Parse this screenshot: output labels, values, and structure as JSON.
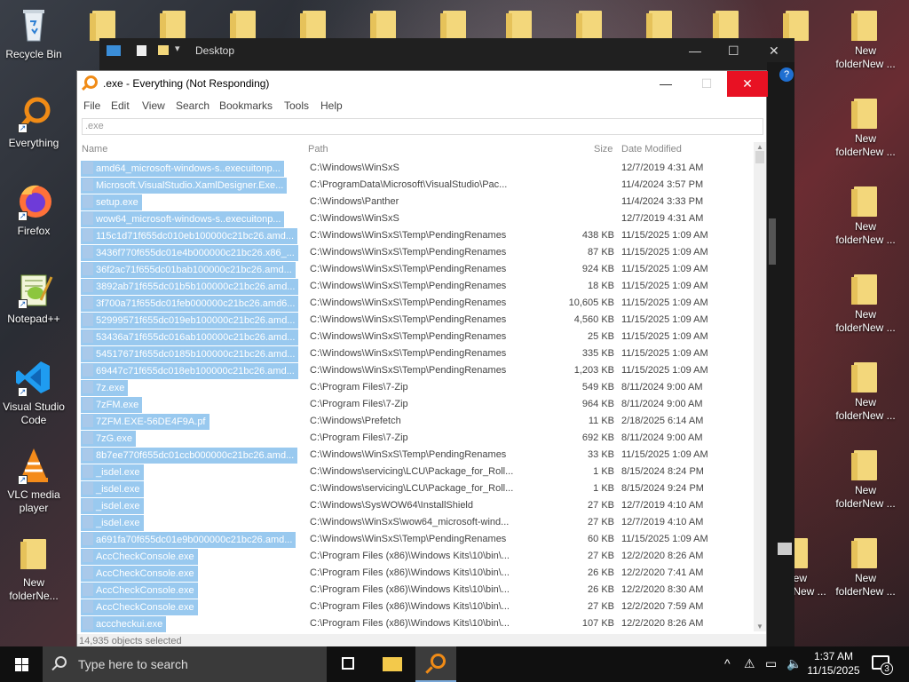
{
  "desktop_left": [
    {
      "label": "Recycle Bin",
      "icon": "recycle-bin-icon"
    },
    {
      "label": "Everything",
      "icon": "everything-icon"
    },
    {
      "label": "Firefox",
      "icon": "firefox-icon"
    },
    {
      "label": "Notepad++",
      "icon": "notepad-plus-plus-icon"
    },
    {
      "label": "Visual Studio Code",
      "icon": "vscode-icon"
    },
    {
      "label": "VLC media player",
      "icon": "vlc-icon"
    },
    {
      "label": "New folderNe...",
      "icon": "folder-icon"
    }
  ],
  "desktop_right": {
    "label_a": "New",
    "label_b": "folderNew ..."
  },
  "explorer": {
    "title": "Desktop"
  },
  "everything": {
    "title": ".exe - Everything (Not Responding)",
    "menu": [
      "File",
      "Edit",
      "View",
      "Search",
      "Bookmarks",
      "Tools",
      "Help"
    ],
    "search_value": ".exe",
    "columns": {
      "name": "Name",
      "path": "Path",
      "size": "Size",
      "date": "Date Modified"
    },
    "rows": [
      {
        "name": "amd64_microsoft-windows-s..execuitonp...",
        "path": "C:\\Windows\\WinSxS",
        "size": "",
        "date": "12/7/2019 4:31 AM"
      },
      {
        "name": "Microsoft.VisualStudio.XamlDesigner.Exe...",
        "path": "C:\\ProgramData\\Microsoft\\VisualStudio\\Pac...",
        "size": "",
        "date": "11/4/2024 3:57 PM"
      },
      {
        "name": "setup.exe",
        "path": "C:\\Windows\\Panther",
        "size": "",
        "date": "11/4/2024 3:33 PM"
      },
      {
        "name": "wow64_microsoft-windows-s..execuitonp...",
        "path": "C:\\Windows\\WinSxS",
        "size": "",
        "date": "12/7/2019 4:31 AM"
      },
      {
        "name": "115c1d71f655dc010eb100000c21bc26.amd...",
        "path": "C:\\Windows\\WinSxS\\Temp\\PendingRenames",
        "size": "438 KB",
        "date": "11/15/2025 1:09 AM"
      },
      {
        "name": "3436f770f655dc01e4b000000c21bc26.x86_...",
        "path": "C:\\Windows\\WinSxS\\Temp\\PendingRenames",
        "size": "87 KB",
        "date": "11/15/2025 1:09 AM"
      },
      {
        "name": "36f2ac71f655dc01bab100000c21bc26.amd...",
        "path": "C:\\Windows\\WinSxS\\Temp\\PendingRenames",
        "size": "924 KB",
        "date": "11/15/2025 1:09 AM"
      },
      {
        "name": "3892ab71f655dc01b5b100000c21bc26.amd...",
        "path": "C:\\Windows\\WinSxS\\Temp\\PendingRenames",
        "size": "18 KB",
        "date": "11/15/2025 1:09 AM"
      },
      {
        "name": "3f700a71f655dc01feb000000c21bc26.amd6...",
        "path": "C:\\Windows\\WinSxS\\Temp\\PendingRenames",
        "size": "10,605 KB",
        "date": "11/15/2025 1:09 AM"
      },
      {
        "name": "52999571f655dc019eb100000c21bc26.amd...",
        "path": "C:\\Windows\\WinSxS\\Temp\\PendingRenames",
        "size": "4,560 KB",
        "date": "11/15/2025 1:09 AM"
      },
      {
        "name": "53436a71f655dc016ab100000c21bc26.amd...",
        "path": "C:\\Windows\\WinSxS\\Temp\\PendingRenames",
        "size": "25 KB",
        "date": "11/15/2025 1:09 AM"
      },
      {
        "name": "54517671f655dc0185b100000c21bc26.amd...",
        "path": "C:\\Windows\\WinSxS\\Temp\\PendingRenames",
        "size": "335 KB",
        "date": "11/15/2025 1:09 AM"
      },
      {
        "name": "69447c71f655dc018eb100000c21bc26.amd...",
        "path": "C:\\Windows\\WinSxS\\Temp\\PendingRenames",
        "size": "1,203 KB",
        "date": "11/15/2025 1:09 AM"
      },
      {
        "name": "7z.exe",
        "path": "C:\\Program Files\\7-Zip",
        "size": "549 KB",
        "date": "8/11/2024 9:00 AM"
      },
      {
        "name": "7zFM.exe",
        "path": "C:\\Program Files\\7-Zip",
        "size": "964 KB",
        "date": "8/11/2024 9:00 AM"
      },
      {
        "name": "7ZFM.EXE-56DE4F9A.pf",
        "path": "C:\\Windows\\Prefetch",
        "size": "11 KB",
        "date": "2/18/2025 6:14 AM"
      },
      {
        "name": "7zG.exe",
        "path": "C:\\Program Files\\7-Zip",
        "size": "692 KB",
        "date": "8/11/2024 9:00 AM"
      },
      {
        "name": "8b7ee770f655dc01ccb000000c21bc26.amd...",
        "path": "C:\\Windows\\WinSxS\\Temp\\PendingRenames",
        "size": "33 KB",
        "date": "11/15/2025 1:09 AM"
      },
      {
        "name": "_isdel.exe",
        "path": "C:\\Windows\\servicing\\LCU\\Package_for_Roll...",
        "size": "1 KB",
        "date": "8/15/2024 8:24 PM"
      },
      {
        "name": "_isdel.exe",
        "path": "C:\\Windows\\servicing\\LCU\\Package_for_Roll...",
        "size": "1 KB",
        "date": "8/15/2024 9:24 PM"
      },
      {
        "name": "_isdel.exe",
        "path": "C:\\Windows\\SysWOW64\\InstallShield",
        "size": "27 KB",
        "date": "12/7/2019 4:10 AM"
      },
      {
        "name": "_isdel.exe",
        "path": "C:\\Windows\\WinSxS\\wow64_microsoft-wind...",
        "size": "27 KB",
        "date": "12/7/2019 4:10 AM"
      },
      {
        "name": "a691fa70f655dc01e9b000000c21bc26.amd...",
        "path": "C:\\Windows\\WinSxS\\Temp\\PendingRenames",
        "size": "60 KB",
        "date": "11/15/2025 1:09 AM"
      },
      {
        "name": "AccCheckConsole.exe",
        "path": "C:\\Program Files (x86)\\Windows Kits\\10\\bin\\...",
        "size": "27 KB",
        "date": "12/2/2020 8:26 AM"
      },
      {
        "name": "AccCheckConsole.exe",
        "path": "C:\\Program Files (x86)\\Windows Kits\\10\\bin\\...",
        "size": "26 KB",
        "date": "12/2/2020 7:41 AM"
      },
      {
        "name": "AccCheckConsole.exe",
        "path": "C:\\Program Files (x86)\\Windows Kits\\10\\bin\\...",
        "size": "26 KB",
        "date": "12/2/2020 8:30 AM"
      },
      {
        "name": "AccCheckConsole.exe",
        "path": "C:\\Program Files (x86)\\Windows Kits\\10\\bin\\...",
        "size": "27 KB",
        "date": "12/2/2020 7:59 AM"
      },
      {
        "name": "acccheckui.exe",
        "path": "C:\\Program Files (x86)\\Windows Kits\\10\\bin\\...",
        "size": "107 KB",
        "date": "12/2/2020 8:26 AM"
      }
    ],
    "status": "14,935 objects selected"
  },
  "taskbar": {
    "search_placeholder": "Type here to search",
    "time": "1:37 AM",
    "date": "11/15/2025",
    "notification_count": "3"
  },
  "colors": {
    "selection": "#99c9ef",
    "close": "#e81123",
    "accent": "#f08b16",
    "taskbar": "#101010"
  }
}
